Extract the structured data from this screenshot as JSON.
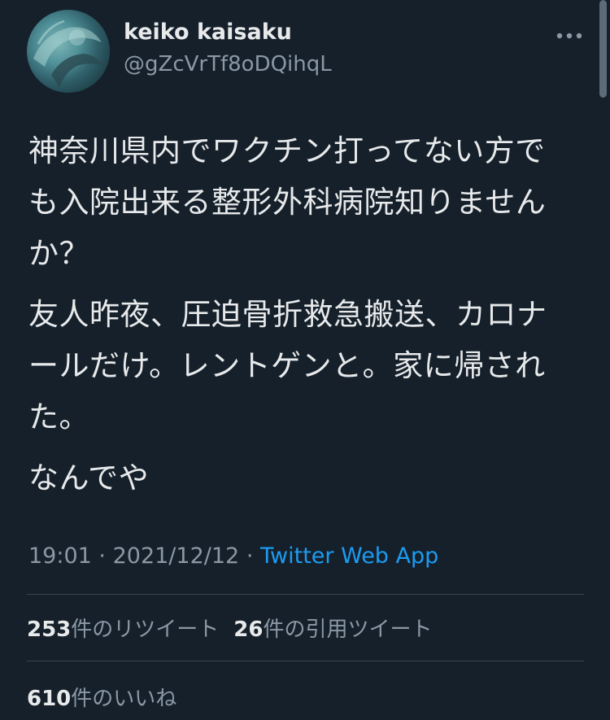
{
  "author": {
    "name": "keiko kaisaku",
    "handle": "@gZcVrTf8oDQihqL"
  },
  "tweet": {
    "paragraphs": [
      "神奈川県内でワクチン打ってない方でも入院出来る整形外科病院知りませんか？",
      "友人昨夜、圧迫骨折救急搬送、カロナールだけ。レントゲンと。家に帰された。",
      "なんでや"
    ],
    "time": "19:01",
    "date": "2021/12/12",
    "separator": "·",
    "source": "Twitter Web App"
  },
  "stats": {
    "retweets_count": "253",
    "retweets_label": "件のリツイート",
    "quotes_count": "26",
    "quotes_label": "件の引用ツイート",
    "likes_count": "610",
    "likes_label": "件のいいね"
  },
  "icons": {
    "more": "more-horizontal-icon"
  },
  "colors": {
    "background": "#15202b",
    "text": "#e7e9ea",
    "secondary": "#8b98a5",
    "link": "#1d9bf0",
    "divider": "#38444d"
  }
}
